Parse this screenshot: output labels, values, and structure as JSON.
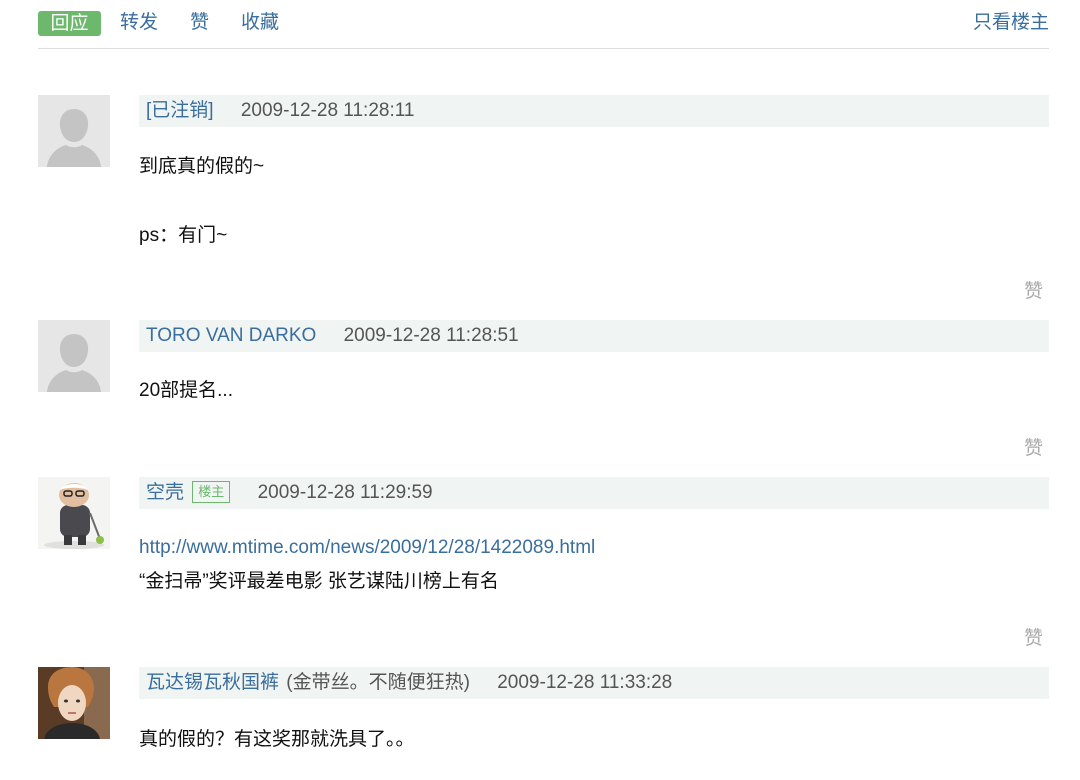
{
  "toolbar": {
    "reply_label": "回应",
    "forward_label": "转发",
    "like_label": "赞",
    "collect_label": "收藏",
    "only_op_label": "只看楼主"
  },
  "comments": [
    {
      "author": "[已注销]",
      "time": "2009-12-28 11:28:11",
      "lines": [
        "到底真的假的~",
        "ps：有门~"
      ],
      "like_label": "赞",
      "avatar": "default-avatar"
    },
    {
      "author": "TORO VAN DARKO",
      "time": "2009-12-28 11:28:51",
      "lines": [
        "20部提名..."
      ],
      "like_label": "赞",
      "avatar": "default-avatar"
    },
    {
      "author": "空壳",
      "badge": "楼主",
      "time": "2009-12-28 11:29:59",
      "link": "http://www.mtime.com/news/2009/12/28/1422089.html",
      "lines": [
        "“金扫帚”奖评最差电影 张艺谋陆川榜上有名"
      ],
      "like_label": "赞",
      "avatar": "old-man-cartoon-avatar"
    },
    {
      "author": "瓦达锡瓦秋国裤",
      "signature": "(金带丝。不随便狂热)",
      "time": "2009-12-28 11:33:28",
      "lines": [
        "真的假的？有这奖那就洗具了。。"
      ],
      "avatar": "portrait-photo-avatar"
    }
  ],
  "colors": {
    "accent_green": "#6cb86c",
    "link_blue": "#3a6e9e",
    "meta_background": "#f0f4f2",
    "muted_gray": "#aaaaaa"
  }
}
